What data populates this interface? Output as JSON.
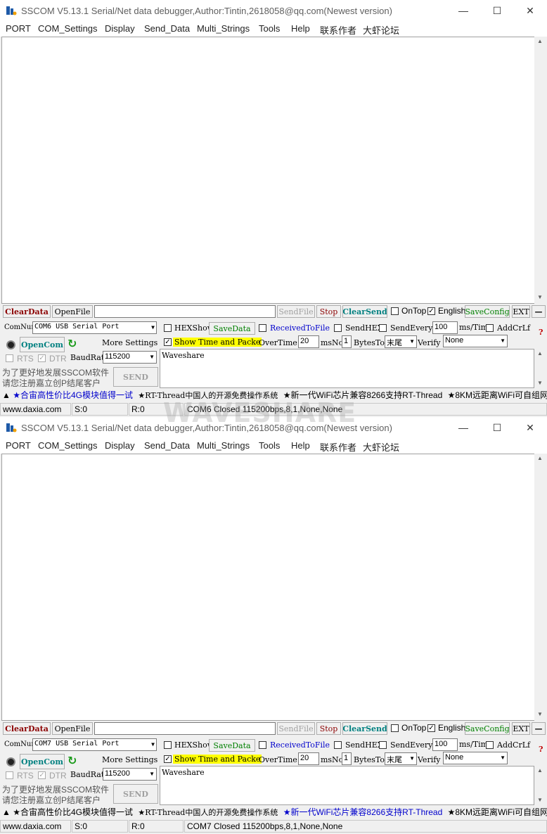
{
  "windows": [
    {
      "title": "SSCOM V5.13.1 Serial/Net data debugger,Author:Tintin,2618058@qq.com(Newest version)",
      "menu": [
        "PORT",
        "COM_Settings",
        "Display",
        "Send_Data",
        "Multi_Strings",
        "Tools",
        "Help",
        "联系作者",
        "大虾论坛"
      ],
      "toolbar": {
        "clear_data": "ClearData",
        "open_file": "OpenFile",
        "file_path": "",
        "send_file": "SendFile",
        "stop": "Stop",
        "clear_send": "ClearSend",
        "on_top": "OnTop",
        "english": "English",
        "save_config": "SaveConfig",
        "ext": "EXT",
        "collapse": "—"
      },
      "port": {
        "com_num_label": "ComNum",
        "com_num": "COM6 USB Serial Port",
        "open_com": "OpenCom",
        "more_settings": "More Settings",
        "rts": "RTS",
        "dtr": "DTR",
        "baud_label": "BaudRat",
        "baud": "115200"
      },
      "options": {
        "hex_show": "HEXShow",
        "save_data": "SaveData",
        "received_to_file": "ReceivedToFile",
        "send_hex": "SendHEX",
        "send_every": "SendEvery:",
        "interval": "100",
        "interval_unit": "ms/Tim",
        "add_crlf": "AddCrLf",
        "show_time": "Show Time and Packe",
        "overtime_label": "OverTime:",
        "overtime": "20",
        "ms": "ms",
        "no_label": "No",
        "no_value": "1",
        "bytes_to": "BytesTo",
        "tail": "末尾",
        "verify_label": "Verify",
        "verify": "None",
        "help": "?"
      },
      "send_text": "Waveshare",
      "send_button": "SEND",
      "promo": [
        "为了更好地发展SSCOM软件",
        "请您注册嘉立创P结尾客户"
      ],
      "ticker": [
        "▲",
        "★合宙高性价比4G模块值得一试",
        "★RT-Thread中国人的开源免费操作系统",
        "★新一代WiFi芯片兼容8266支持RT-Thread",
        "★8KM远距离WiFi可自组网"
      ],
      "status": {
        "site": "www.daxia.com",
        "sent": "S:0",
        "recv": "R:0",
        "port_state": "COM6 Closed  115200bps,8,1,None,None"
      }
    },
    {
      "title": "SSCOM V5.13.1 Serial/Net data debugger,Author:Tintin,2618058@qq.com(Newest version)",
      "menu": [
        "PORT",
        "COM_Settings",
        "Display",
        "Send_Data",
        "Multi_Strings",
        "Tools",
        "Help",
        "联系作者",
        "大虾论坛"
      ],
      "toolbar": {
        "clear_data": "ClearData",
        "open_file": "OpenFile",
        "file_path": "",
        "send_file": "SendFile",
        "stop": "Stop",
        "clear_send": "ClearSend",
        "on_top": "OnTop",
        "english": "English",
        "save_config": "SaveConfig",
        "ext": "EXT",
        "collapse": "—"
      },
      "port": {
        "com_num_label": "ComNum",
        "com_num": "COM7 USB Serial Port",
        "open_com": "OpenCom",
        "more_settings": "More Settings",
        "rts": "RTS",
        "dtr": "DTR",
        "baud_label": "BaudRat",
        "baud": "115200"
      },
      "options": {
        "hex_show": "HEXShow",
        "save_data": "SaveData",
        "received_to_file": "ReceivedToFile",
        "send_hex": "SendHEX",
        "send_every": "SendEvery:",
        "interval": "100",
        "interval_unit": "ms/Tim",
        "add_crlf": "AddCrLf",
        "show_time": "Show Time and Packe",
        "overtime_label": "OverTime:",
        "overtime": "20",
        "ms": "ms",
        "no_label": "No",
        "no_value": "1",
        "bytes_to": "BytesTo",
        "tail": "末尾",
        "verify_label": "Verify",
        "verify": "None",
        "help": "?"
      },
      "send_text": "Waveshare",
      "send_button": "SEND",
      "promo": [
        "为了更好地发展SSCOM软件",
        "请您注册嘉立创P结尾客户"
      ],
      "ticker": [
        "▲",
        "★合宙高性价比4G模块值得一试",
        "★RT-Thread中国人的开源免费操作系统",
        "★新一代WiFi芯片兼容8266支持RT-Thread",
        "★8KM远距离WiFi可自组网"
      ],
      "status": {
        "site": "www.daxia.com",
        "sent": "S:0",
        "recv": "R:0",
        "port_state": "COM7 Closed  115200bps,8,1,None,None"
      }
    }
  ],
  "watermark": "WAVESHARE",
  "colors": {
    "clear_data": "#8b0000",
    "clear_send": "#008080",
    "highlight": "#ffff00",
    "ticker_blue": "#0000cc"
  }
}
